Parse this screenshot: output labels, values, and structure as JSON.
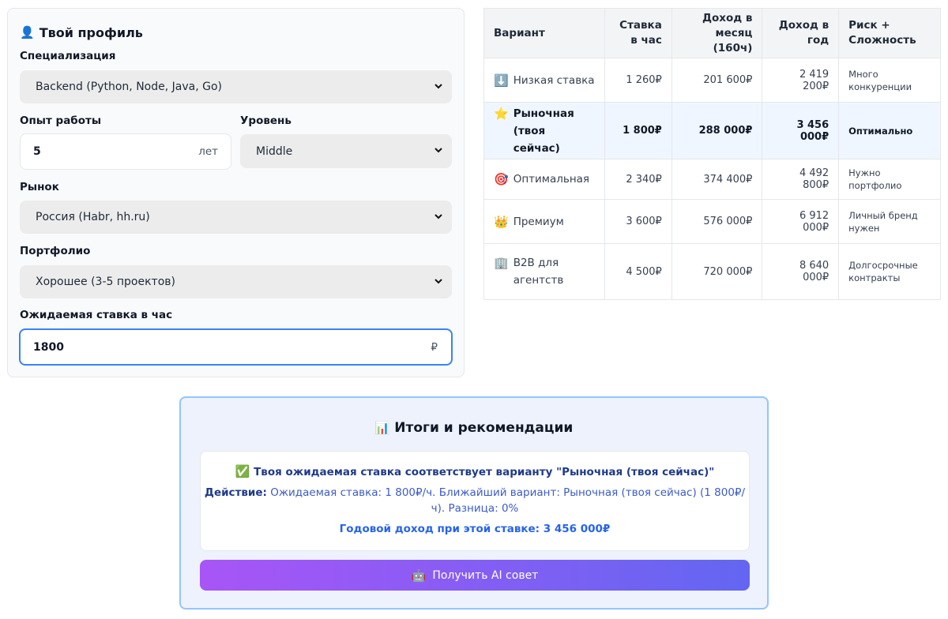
{
  "profile": {
    "icon": "person-icon",
    "title": "Твой профиль",
    "specialization_label": "Специализация",
    "specialization_value": "Backend (Python, Node, Java, Go)",
    "experience_label": "Опыт работы",
    "experience_value": "5",
    "experience_suffix": "лет",
    "level_label": "Уровень",
    "level_value": "Middle",
    "market_label": "Рынок",
    "market_value": "Россия (Habr, hh.ru)",
    "portfolio_label": "Портфолио",
    "portfolio_value": "Хорошее (3-5 проектов)",
    "rate_label": "Ожидаемая ставка в час",
    "rate_value": "1800",
    "rate_suffix": "₽"
  },
  "table": {
    "headers": [
      "Вариант",
      "Ставка в час",
      "Доход в месяц (160ч)",
      "Доход в год",
      "Риск + Сложность"
    ],
    "rows": [
      {
        "emoji": "⬇️",
        "icon": "down-arrow-icon",
        "name": "Низкая ставка",
        "rate": "1 260₽",
        "month": "201 600₽",
        "year": "2 419 200₽",
        "risk": "Много конкуренции"
      },
      {
        "emoji": "⭐",
        "icon": "star-icon",
        "name": "Рыночная (твоя сейчас)",
        "rate": "1 800₽",
        "month": "288 000₽",
        "year": "3 456 000₽",
        "risk": "Оптимально"
      },
      {
        "emoji": "🎯",
        "icon": "target-icon",
        "name": "Оптимальная",
        "rate": "2 340₽",
        "month": "374 400₽",
        "year": "4 492 800₽",
        "risk": "Нужно портфолио"
      },
      {
        "emoji": "👑",
        "icon": "crown-icon",
        "name": "Премиум",
        "rate": "3 600₽",
        "month": "576 000₽",
        "year": "6 912 000₽",
        "risk": "Личный бренд нужен"
      },
      {
        "emoji": "🏢",
        "icon": "building-icon",
        "name": "B2B для агентств",
        "rate": "4 500₽",
        "month": "720 000₽",
        "year": "8 640 000₽",
        "risk": "Долгосрочные контракты"
      }
    ]
  },
  "summary": {
    "icon": "bar-chart-icon",
    "title": "Итоги и рекомендации",
    "match_icon": "check-mark-icon",
    "match_text": "Твоя ожидаемая ставка соответствует варианту \"Рыночная (твоя сейчас)\"",
    "action_label": "Действие:",
    "action_text": "Ожидаемая ставка: 1 800₽/ч. Ближайший вариант: Рыночная (твоя сейчас) (1 800₽/ч). Разница: 0%",
    "annual_text": "Годовой доход при этой ставке: 3 456 000₽",
    "ai_icon": "robot-icon",
    "ai_button": "Получить AI совет"
  },
  "colors": {
    "accent": "#3b82f6",
    "highlight_row": "#eff6ff",
    "button_gradient_start": "#a855f7",
    "button_gradient_end": "#6366f1"
  }
}
